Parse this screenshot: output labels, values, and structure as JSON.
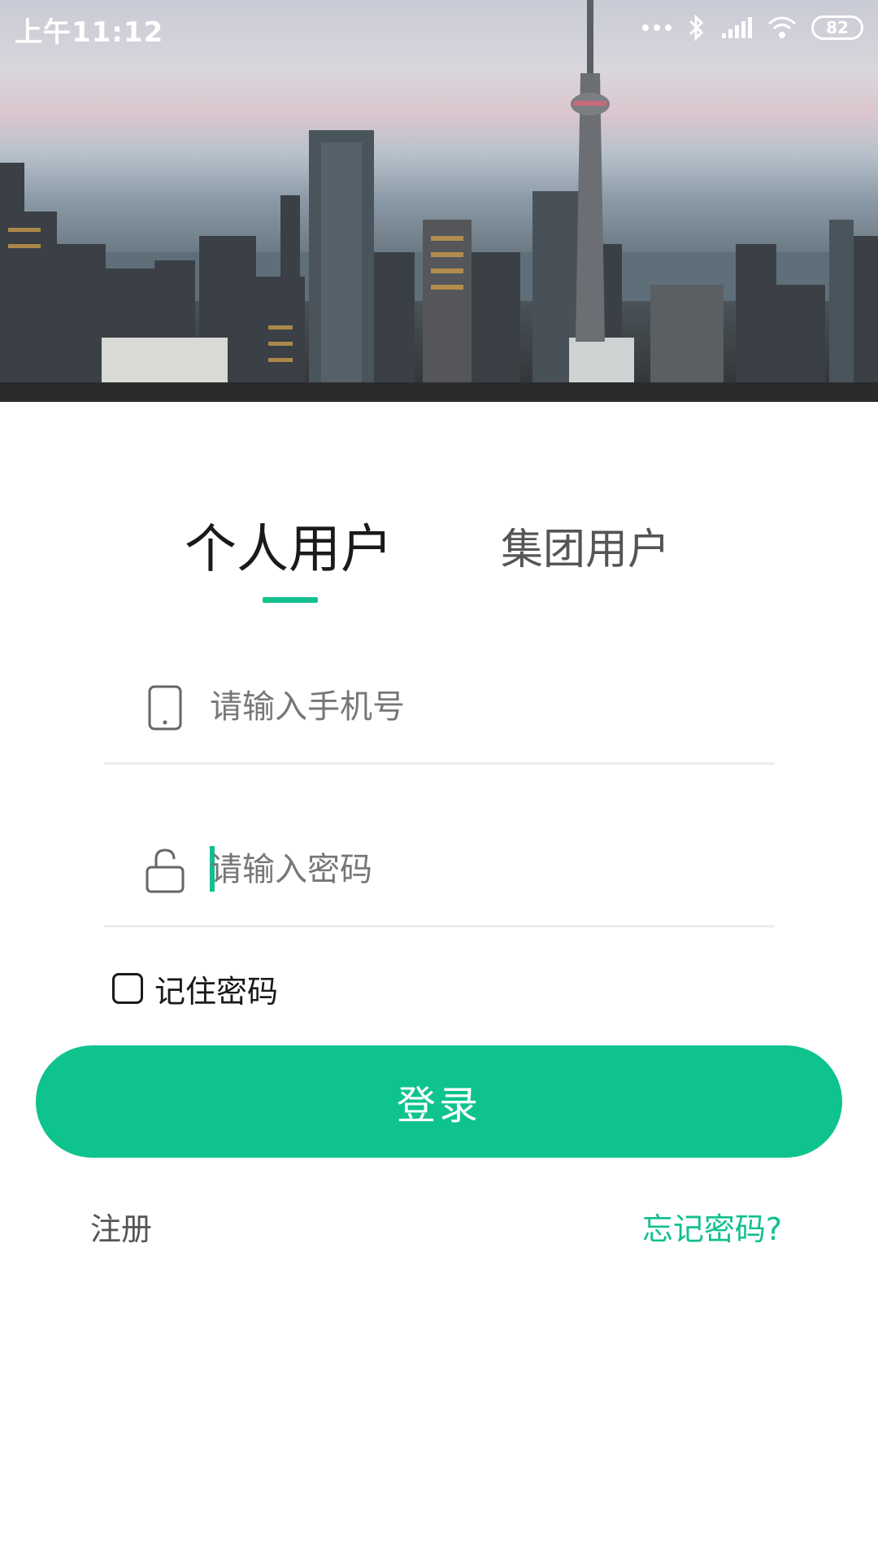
{
  "status_bar": {
    "time": "上午11:12",
    "battery": "82",
    "icons": [
      "more-dots-icon",
      "bluetooth-icon",
      "signal-icon",
      "wifi-icon",
      "battery-icon"
    ]
  },
  "hero": {
    "image": "city-skyline-photo"
  },
  "tabs": {
    "items": [
      {
        "label": "个人用户",
        "active": true
      },
      {
        "label": "集团用户",
        "active": false
      }
    ]
  },
  "form": {
    "phone": {
      "placeholder": "请输入手机号",
      "value": "",
      "icon": "phone-icon"
    },
    "password": {
      "placeholder": "请输入密码",
      "value": "",
      "icon": "lock-icon"
    },
    "remember": {
      "label": "记住密码",
      "checked": false
    }
  },
  "actions": {
    "login_label": "登录",
    "register_label": "注册",
    "forgot_label": "忘记密码?"
  },
  "colors": {
    "accent": "#11c08f",
    "button": "#0ec38e",
    "text_dark": "#1a1a1a",
    "text_muted": "#555555"
  }
}
